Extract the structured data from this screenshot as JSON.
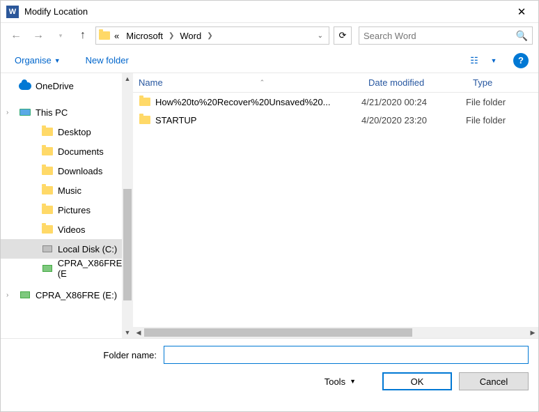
{
  "window": {
    "title": "Modify Location"
  },
  "breadcrumb": {
    "prefix": "«",
    "items": [
      "Microsoft",
      "Word"
    ]
  },
  "search": {
    "placeholder": "Search Word"
  },
  "toolbar": {
    "organise": "Organise",
    "newfolder": "New folder"
  },
  "columns": {
    "name": "Name",
    "date": "Date modified",
    "type": "Type"
  },
  "tree": [
    {
      "label": "OneDrive",
      "icon": "cloud",
      "indent": false
    },
    {
      "label": "This PC",
      "icon": "pc",
      "indent": false,
      "chev": true
    },
    {
      "label": "Desktop",
      "icon": "folder",
      "indent": true
    },
    {
      "label": "Documents",
      "icon": "folder",
      "indent": true
    },
    {
      "label": "Downloads",
      "icon": "folder",
      "indent": true
    },
    {
      "label": "Music",
      "icon": "folder",
      "indent": true
    },
    {
      "label": "Pictures",
      "icon": "folder",
      "indent": true
    },
    {
      "label": "Videos",
      "icon": "folder",
      "indent": true
    },
    {
      "label": "Local Disk (C:)",
      "icon": "disk",
      "indent": true,
      "selected": true
    },
    {
      "label": "CPRA_X86FRE (E",
      "icon": "drive",
      "indent": true
    },
    {
      "label": "CPRA_X86FRE (E:)",
      "icon": "drive",
      "indent": false,
      "chev": true
    }
  ],
  "files": [
    {
      "name": "How%20to%20Recover%20Unsaved%20...",
      "date": "4/21/2020 00:24",
      "type": "File folder"
    },
    {
      "name": "STARTUP",
      "date": "4/20/2020 23:20",
      "type": "File folder"
    }
  ],
  "bottom": {
    "folder_label": "Folder name:",
    "folder_value": "",
    "tools": "Tools",
    "ok": "OK",
    "cancel": "Cancel"
  }
}
